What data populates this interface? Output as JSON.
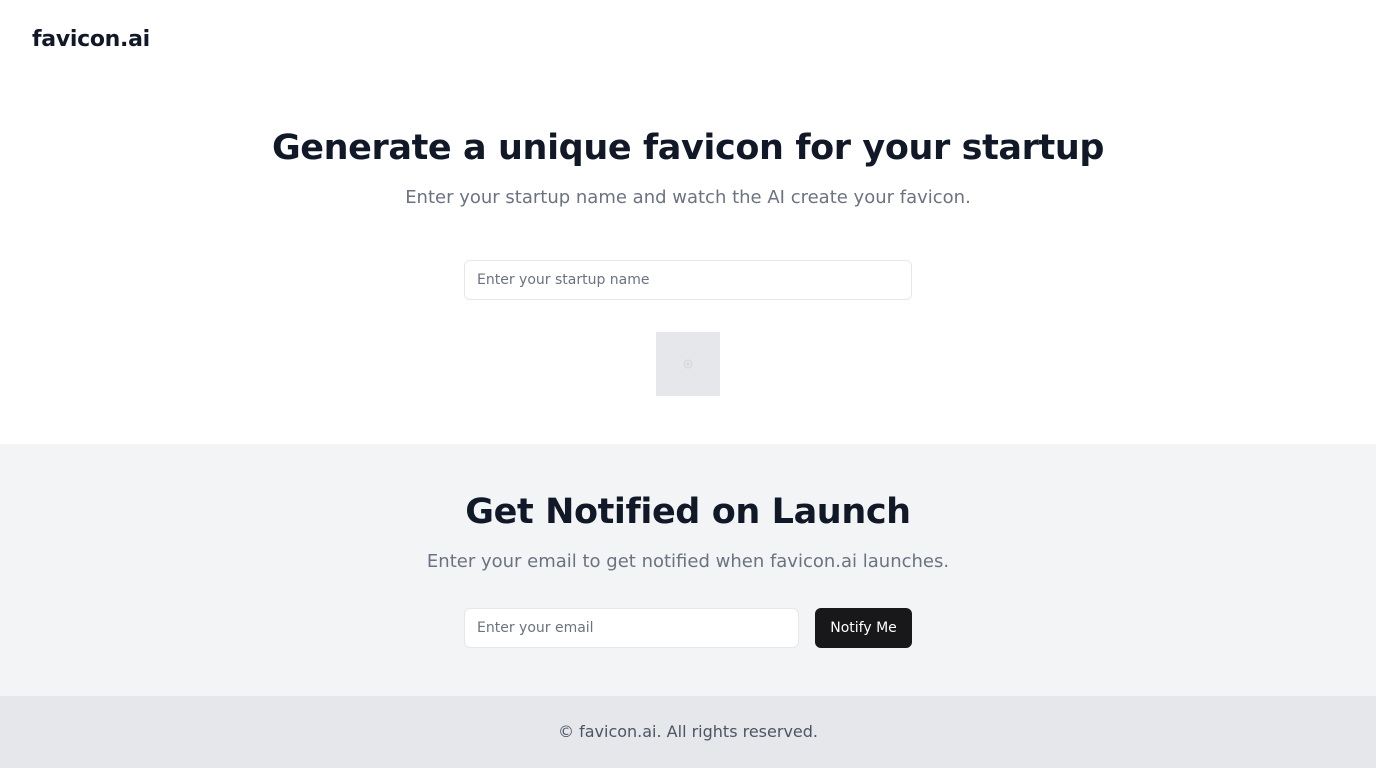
{
  "header": {
    "logo": "favicon.ai"
  },
  "hero": {
    "title": "Generate a unique favicon for your startup",
    "subtitle": "Enter your startup name and watch the AI create your favicon.",
    "name_input": {
      "value": "",
      "placeholder": "Enter your startup name"
    },
    "preview": {
      "icon": "image-placeholder-icon"
    }
  },
  "notify": {
    "title": "Get Notified on Launch",
    "subtitle": "Enter your email to get notified when favicon.ai launches.",
    "email_input": {
      "value": "",
      "placeholder": "Enter your email"
    },
    "button_label": "Notify Me"
  },
  "footer": {
    "text": "© favicon.ai. All rights reserved."
  },
  "colors": {
    "primary_text": "#111827",
    "muted_text": "#6b7280",
    "button_bg": "#18181b",
    "notify_bg": "#f3f4f6",
    "footer_bg": "#e5e7eb"
  }
}
